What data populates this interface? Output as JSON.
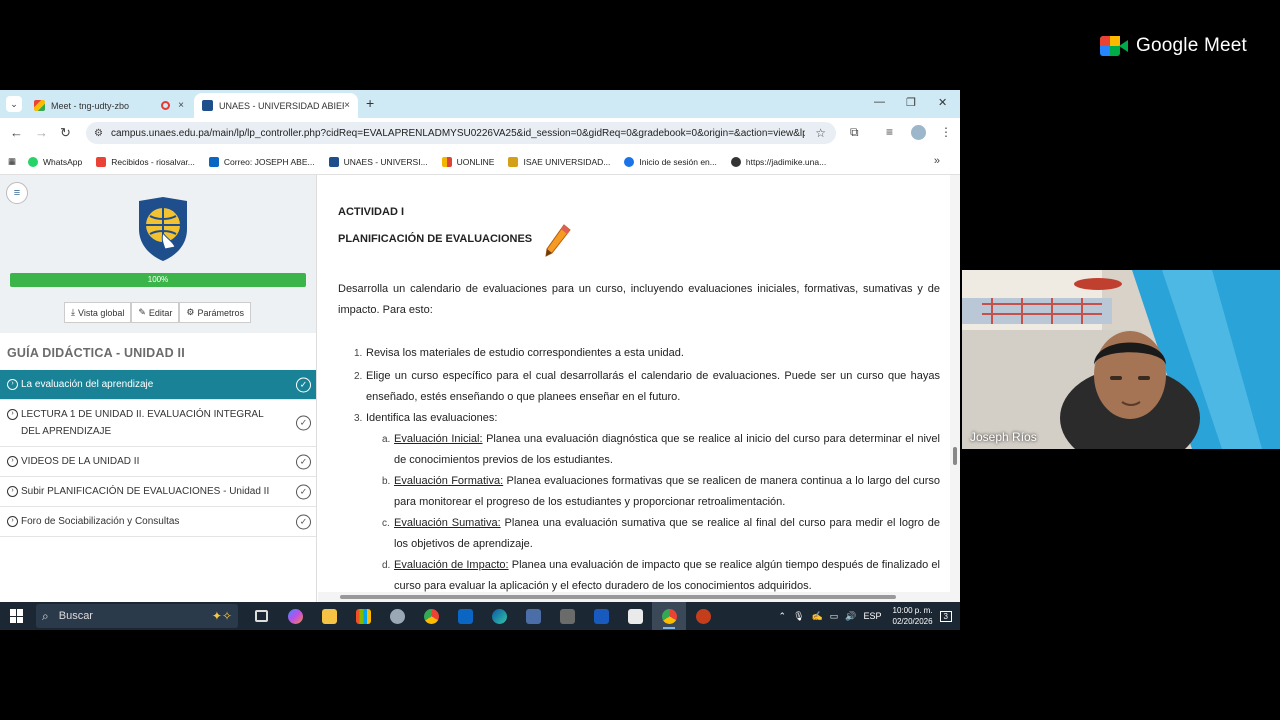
{
  "meet": {
    "brand": "Google Meet",
    "participant_name": "Joseph Ríos"
  },
  "browser": {
    "tabs": [
      {
        "title": "Meet - tng-udty-zbo",
        "close": "×"
      },
      {
        "title": "UNAES - UNIVERSIDAD ABIERTA",
        "close": "×"
      }
    ],
    "new_tab": "+",
    "url": "campus.unaes.edu.pa/main/lp/lp_controller.php?cidReq=EVALAPRENLADMYSU0226VA25&id_session=0&gidReq=0&gradebook=0&origin=&action=view&lp...",
    "bookmarks": [
      {
        "label": "WhatsApp",
        "color": "#25d366"
      },
      {
        "label": "Recibidos - riosalvar...",
        "color": "#ea4335"
      },
      {
        "label": "Correo: JOSEPH ABE...",
        "color": "#0a66c2"
      },
      {
        "label": "UNAES - UNIVERSI...",
        "color": "#1f4e8c"
      },
      {
        "label": "UONLINE",
        "color": "#f4b400"
      },
      {
        "label": "ISAE UNIVERSIDAD...",
        "color": "#d4a017"
      },
      {
        "label": "Inicio de sesión en...",
        "color": "#1a73e8"
      },
      {
        "label": "https://jadimike.una...",
        "color": "#333333"
      }
    ],
    "bookmarks_more": "»"
  },
  "sidebar": {
    "progress_pct": 100,
    "progress_label": "100%",
    "buttons": [
      {
        "icon": "⤓",
        "label": "Vista global"
      },
      {
        "icon": "✎",
        "label": "Editar"
      },
      {
        "icon": "⚙",
        "label": "Parámetros"
      }
    ],
    "title": "GUÍA DIDÁCTICA - UNIDAD II",
    "items": [
      {
        "label": "La evaluación del aprendizaje",
        "active": true
      },
      {
        "label": "LECTURA 1 DE UNIDAD II. EVALUACIÓN INTEGRAL DEL APRENDIZAJE",
        "active": false
      },
      {
        "label": "VIDEOS DE LA UNIDAD II",
        "active": false
      },
      {
        "label": "Subir PLANIFICACIÓN DE EVALUACIONES - Unidad II",
        "active": false
      },
      {
        "label": "Foro de Sociabilización y Consultas",
        "active": false
      }
    ]
  },
  "document": {
    "activity": "ACTIVIDAD I",
    "heading": "PLANIFICACIÓN DE EVALUACIONES",
    "intro": "Desarrolla un calendario de evaluaciones para un curso, incluyendo evaluaciones iniciales, formativas, sumativas y de impacto. Para esto:",
    "steps": [
      {
        "n": "1.",
        "text": "Revisa los materiales de estudio correspondientes a esta unidad."
      },
      {
        "n": "2.",
        "text": "Elige un curso específico para el cual desarrollarás el calendario de evaluaciones. Puede ser un curso que hayas enseñado, estés enseñando o que planees enseñar en el futuro."
      },
      {
        "n": "3.",
        "text": "Identifica las evaluaciones:"
      }
    ],
    "substeps": [
      {
        "n": "a.",
        "term": "Evaluación Inicial:",
        "text": " Planea una evaluación diagnóstica que se realice al inicio del curso para determinar el nivel de conocimientos previos de los estudiantes."
      },
      {
        "n": "b.",
        "term": "Evaluación Formativa:",
        "text": " Planea evaluaciones formativas que se realicen de manera continua a lo largo del curso para monitorear el progreso de los estudiantes y proporcionar retroalimentación."
      },
      {
        "n": "c.",
        "term": "Evaluación Sumativa:",
        "text": " Planea una evaluación sumativa que se realice al final del curso para medir el logro de los objetivos de aprendizaje."
      },
      {
        "n": "d.",
        "term": "Evaluación de Impacto:",
        "text": " Planea una evaluación de impacto que se realice algún tiempo después de finalizado el curso para evaluar la aplicación y el efecto duradero de los conocimientos adquiridos."
      }
    ]
  },
  "taskbar": {
    "search_placeholder": "Buscar",
    "lang": "ESP",
    "time": "10:00 p. m.",
    "date": "02/20/2026",
    "notifications": "3"
  }
}
